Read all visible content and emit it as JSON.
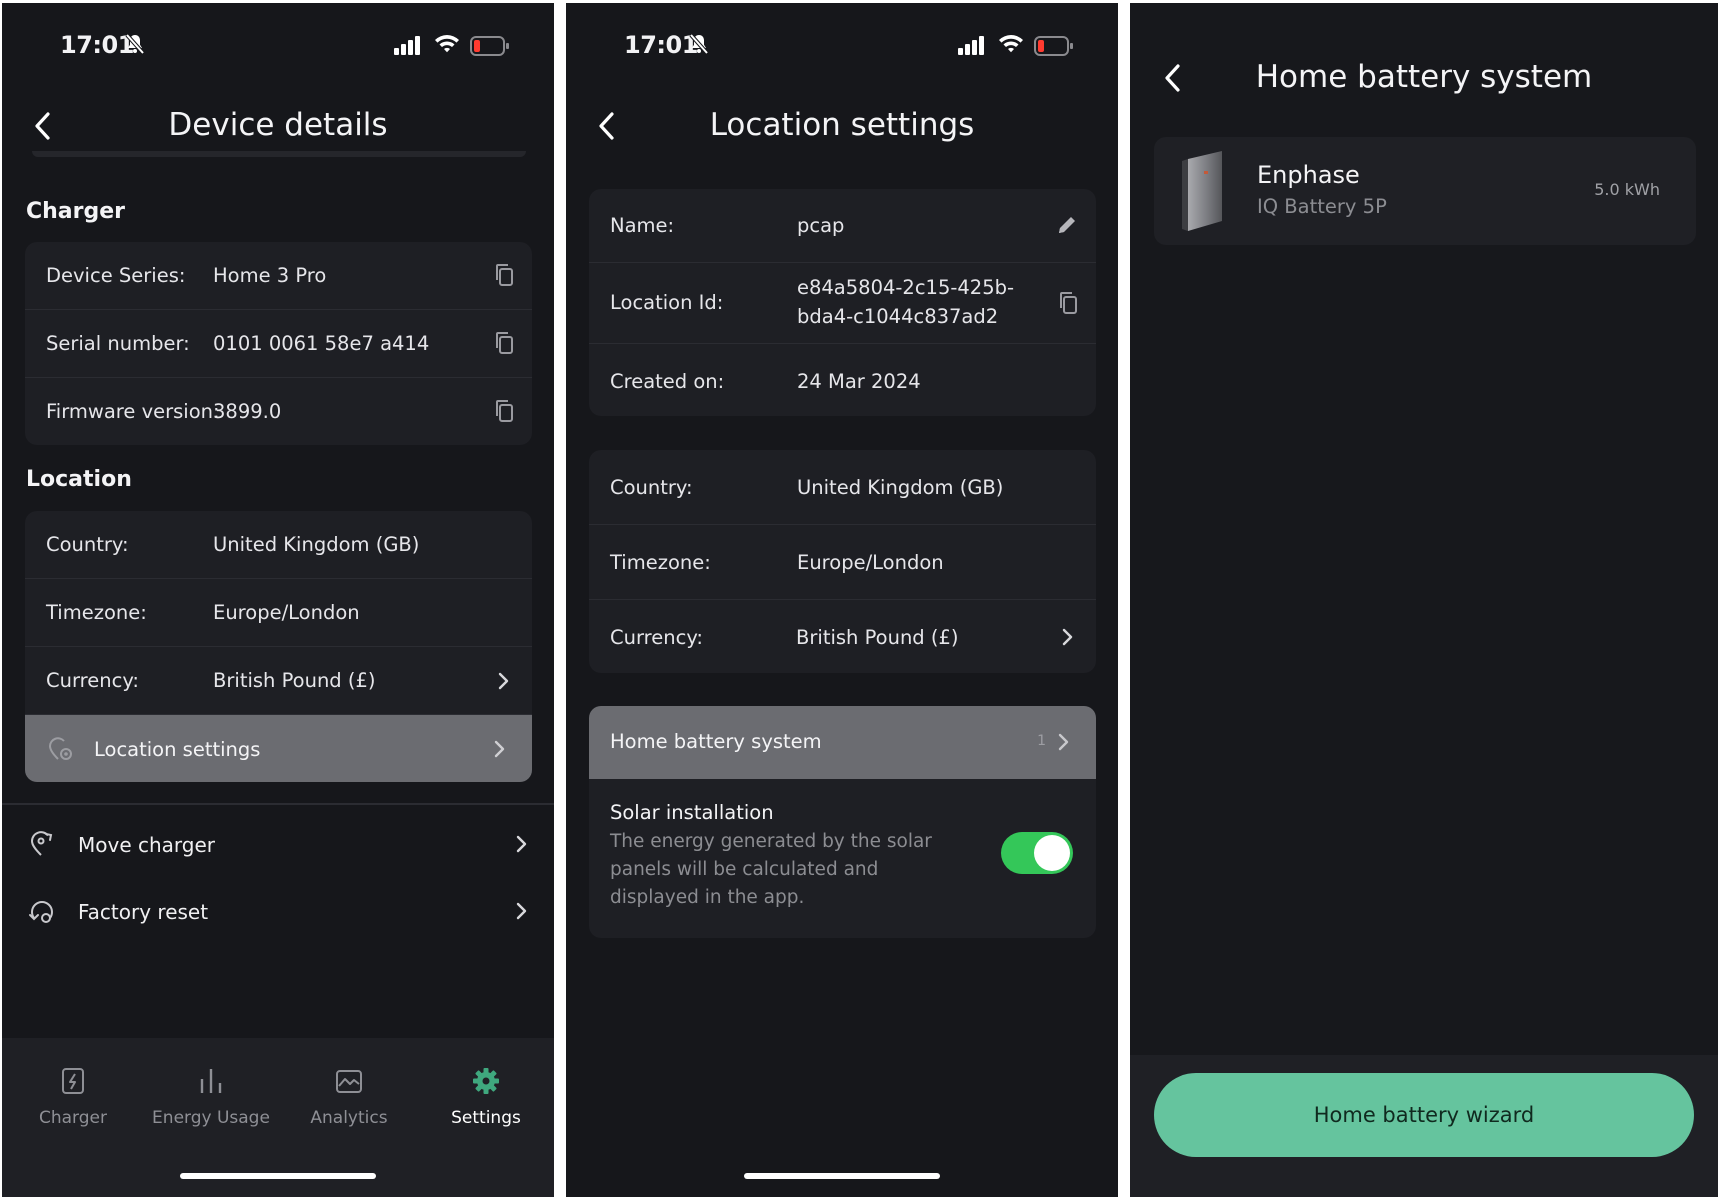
{
  "screen1": {
    "status": {
      "time": "17:01"
    },
    "title": "Device details",
    "charger_section": "Charger",
    "charger_rows": [
      {
        "label": "Device Series:",
        "value": "Home 3 Pro"
      },
      {
        "label": "Serial number:",
        "value": "0101 0061 58e7 a414"
      },
      {
        "label": "Firmware version:",
        "value": "3899.0"
      }
    ],
    "location_section": "Location",
    "location_rows": [
      {
        "label": "Country:",
        "value": "United Kingdom (GB)"
      },
      {
        "label": "Timezone:",
        "value": "Europe/London"
      },
      {
        "label": "Currency:",
        "value": "British Pound (£)"
      }
    ],
    "location_settings": "Location settings",
    "actions": [
      {
        "label": "Move charger",
        "icon": "move-charger-icon"
      },
      {
        "label": "Factory reset",
        "icon": "factory-reset-icon"
      }
    ],
    "tabs": [
      {
        "label": "Charger",
        "icon": "charger-icon"
      },
      {
        "label": "Energy Usage",
        "icon": "energy-usage-icon"
      },
      {
        "label": "Analytics",
        "icon": "analytics-icon"
      },
      {
        "label": "Settings",
        "icon": "settings-gear-icon",
        "active": true
      }
    ],
    "accent_color": "#3fa87e"
  },
  "screen2": {
    "status": {
      "time": "17:01"
    },
    "title": "Location settings",
    "info_rows": [
      {
        "label": "Name:",
        "value": "pcap"
      },
      {
        "label": "Location Id:",
        "value_line1": "e84a5804-2c15-425b-",
        "value_line2": "bda4-c1044c837ad2"
      },
      {
        "label": "Created on:",
        "value": "24 Mar 2024"
      }
    ],
    "region_rows": [
      {
        "label": "Country:",
        "value": "United Kingdom (GB)"
      },
      {
        "label": "Timezone:",
        "value": "Europe/London"
      },
      {
        "label": "Currency:",
        "value": "British Pound (£)"
      }
    ],
    "home_battery": {
      "label": "Home battery system",
      "count": "1"
    },
    "solar": {
      "title": "Solar installation",
      "desc_line1": "The energy generated by the solar",
      "desc_line2": "panels will be calculated and",
      "desc_line3": "displayed in the app.",
      "enabled": true
    }
  },
  "screen3": {
    "title": "Home battery system",
    "battery": {
      "brand": "Enphase",
      "model": "IQ Battery 5P",
      "capacity": "5.0 kWh"
    },
    "wizard_button": "Home battery wizard",
    "button_color": "#65c49e"
  }
}
